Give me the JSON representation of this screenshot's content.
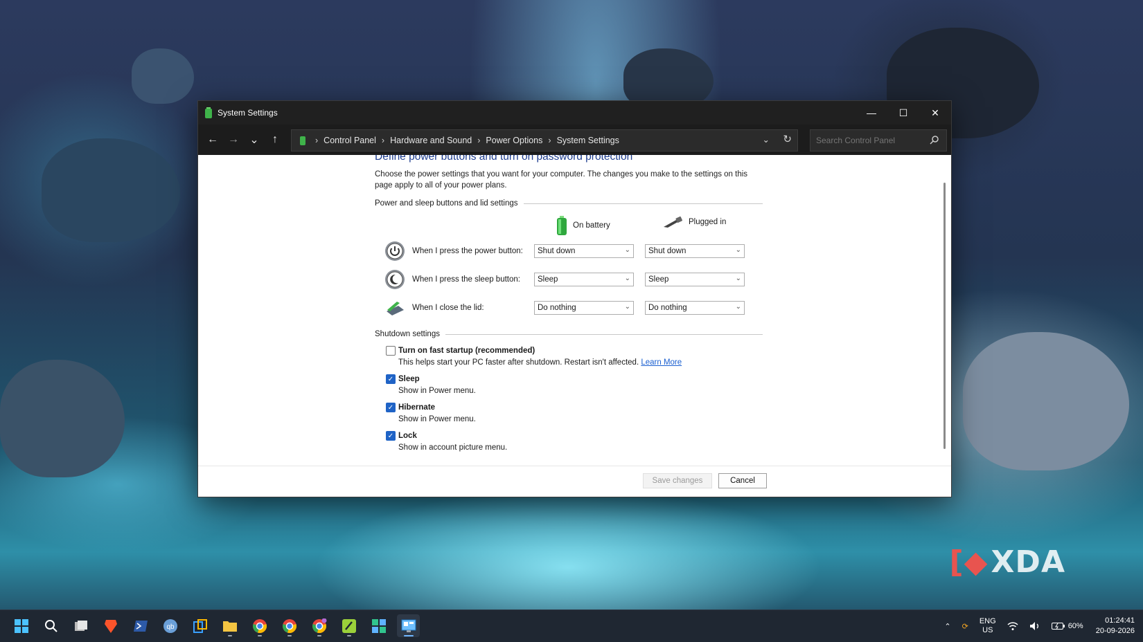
{
  "window": {
    "title": "System Settings",
    "controls": {
      "minimize": "—",
      "maximize": "☐",
      "close": "✕"
    }
  },
  "nav": {
    "back": "←",
    "forward": "→",
    "recent": "⌄",
    "up": "↑",
    "breadcrumb": [
      "Control Panel",
      "Hardware and Sound",
      "Power Options",
      "System Settings"
    ],
    "search_placeholder": "Search Control Panel"
  },
  "page": {
    "heading": "Define power buttons and turn on password protection",
    "description": "Choose the power settings that you want for your computer. The changes you make to the settings on this page apply to all of your power plans.",
    "section_buttons": "Power and sleep buttons and lid settings",
    "col_battery": "On battery",
    "col_plugged": "Plugged in",
    "rows": [
      {
        "label": "When I press the power button:",
        "battery": "Shut down",
        "plugged": "Shut down",
        "icon": "power-icon"
      },
      {
        "label": "When I press the sleep button:",
        "battery": "Sleep",
        "plugged": "Sleep",
        "icon": "sleep-icon"
      },
      {
        "label": "When I close the lid:",
        "battery": "Do nothing",
        "plugged": "Do nothing",
        "icon": "laptop-lid-icon"
      }
    ],
    "section_shutdown": "Shutdown settings",
    "options": [
      {
        "label": "Turn on fast startup (recommended)",
        "desc": "This helps start your PC faster after shutdown. Restart isn't affected.",
        "link": "Learn More",
        "checked": false
      },
      {
        "label": "Sleep",
        "desc": "Show in Power menu.",
        "checked": true
      },
      {
        "label": "Hibernate",
        "desc": "Show in Power menu.",
        "checked": true
      },
      {
        "label": "Lock",
        "desc": "Show in account picture menu.",
        "checked": true
      }
    ],
    "save_label": "Save changes",
    "cancel_label": "Cancel"
  },
  "taskbar": {
    "tray": {
      "lang1": "ENG",
      "lang2": "US",
      "battery": "60%",
      "time": "01:24:41",
      "date": "20-09-2026"
    }
  },
  "watermark": "XDA",
  "colors": {
    "accent": "#1f63c6",
    "heading": "#1e3d8f",
    "titlebar": "#202020",
    "taskbar": "#1f2732"
  }
}
